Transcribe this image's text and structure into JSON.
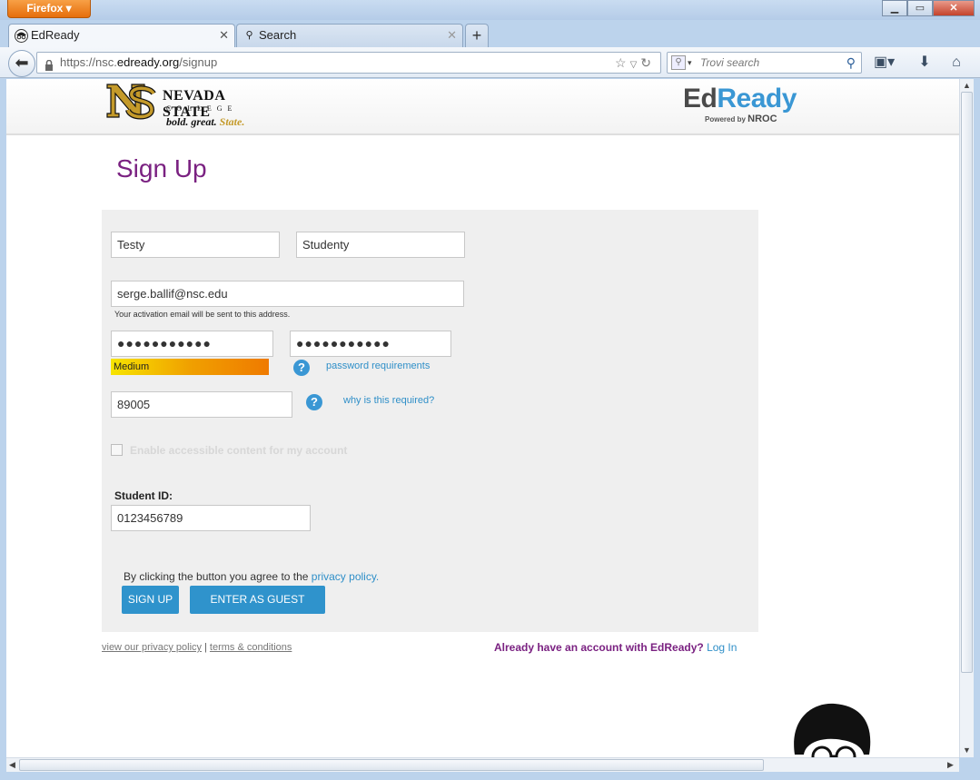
{
  "browser": {
    "app_button": "Firefox",
    "tabs": [
      {
        "label": "EdReady",
        "active": true
      },
      {
        "label": "Search",
        "active": false
      }
    ],
    "url_prefix": "https://nsc.",
    "url_domain": "edready.org",
    "url_path": "/signup",
    "search_placeholder": "Trovi search"
  },
  "header": {
    "nsc_name": "NEVADA STATE",
    "nsc_college": "COLLEGE",
    "nsc_tag_a": "bold. great. ",
    "nsc_tag_b": "State.",
    "edready_ed": "Ed",
    "edready_ready": "Ready",
    "powered_by": "Powered by",
    "nroc": "NROC"
  },
  "form": {
    "title": "Sign Up",
    "first_name": "Testy",
    "last_name": "Studenty",
    "email": "serge.ballif@nsc.edu",
    "email_hint": "Your activation email will be sent to this address.",
    "password": "●●●●●●●●●●●",
    "password_confirm": "●●●●●●●●●●●",
    "strength": "Medium",
    "strength_level": 0.5,
    "password_requirements": "password requirements",
    "zip": "89005",
    "why_required": "why is this required?",
    "accessible_label": "Enable accessible content for my account",
    "student_id_label": "Student ID:",
    "student_id": "0123456789",
    "agree_text": "By clicking the button you agree to the ",
    "privacy_link": "privacy policy.",
    "signup_button": "SIGN UP",
    "guest_button": "ENTER AS GUEST"
  },
  "footer": {
    "privacy": "view our privacy policy",
    "separator": "|",
    "terms": "terms & conditions",
    "have_account": "Already have an account with EdReady? ",
    "login": "Log In"
  },
  "colors": {
    "brand_purple": "#7a2181",
    "brand_blue": "#2f93cc",
    "nsc_gold": "#c49a2a"
  },
  "icons": {
    "back": "back-arrow-icon",
    "lock": "lock-icon",
    "bookmark_star": "star-icon",
    "reload": "reload-icon",
    "search": "magnifier-icon",
    "bookmarks": "bookmarks-icon",
    "download": "download-icon",
    "home": "home-icon",
    "help": "question-icon"
  }
}
